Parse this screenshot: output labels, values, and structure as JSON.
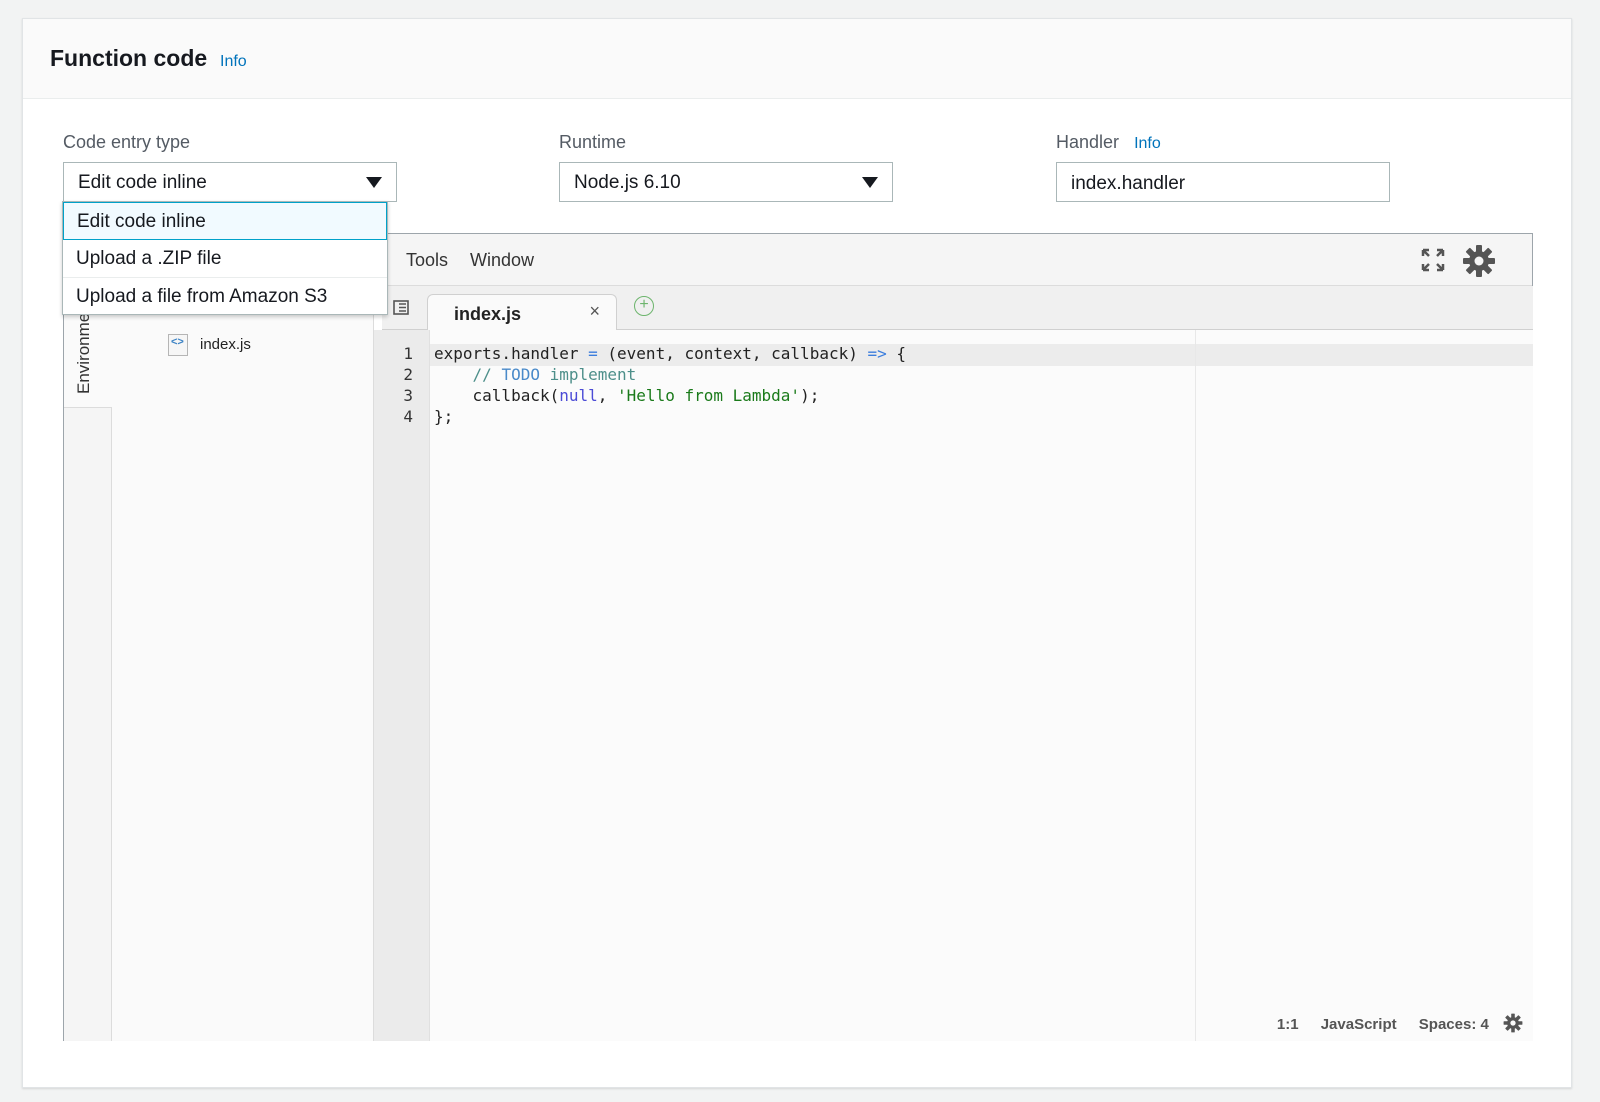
{
  "panel": {
    "title": "Function code",
    "info_label": "Info"
  },
  "fields": {
    "code_entry_type": {
      "label": "Code entry type",
      "value": "Edit code inline",
      "options": [
        "Edit code inline",
        "Upload a .ZIP file",
        "Upload a file from Amazon S3"
      ]
    },
    "runtime": {
      "label": "Runtime",
      "value": "Node.js 6.10"
    },
    "handler": {
      "label": "Handler",
      "info_label": "Info",
      "value": "index.handler"
    }
  },
  "ide": {
    "menu": [
      "Tools",
      "Window"
    ],
    "side_tab_label": "Environment",
    "tree_file": "index.js",
    "open_tab": "index.js",
    "line_numbers": [
      "1",
      "2",
      "3",
      "4"
    ],
    "code": {
      "line1_a": "exports.handler ",
      "line1_op1": "=",
      "line1_b": " (event, context, callback) ",
      "line1_op2": "=>",
      "line1_c": " {",
      "line2_a": "    // ",
      "line2_todo": "TODO",
      "line2_b": " implement",
      "line3_a": "    callback(",
      "line3_null": "null",
      "line3_b": ", ",
      "line3_str": "'Hello from Lambda'",
      "line3_c": ");",
      "line4": "};"
    },
    "status": {
      "cursor": "1:1",
      "language": "JavaScript",
      "spaces": "Spaces: 4"
    }
  },
  "colors": {
    "info_link": "#0073bb",
    "selected_border": "#00a1c9",
    "string": "#1a7a1a",
    "keyword_null": "#4b4bd6"
  }
}
